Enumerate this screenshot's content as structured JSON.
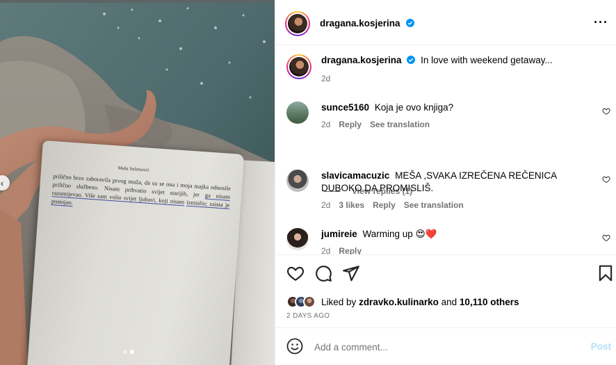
{
  "post": {
    "author": "dragana.kosjerina",
    "caption": "In love with weekend getaway...",
    "caption_time": "2d",
    "more_icon": "more-horizontal-icon",
    "verified_color": "#0095f6"
  },
  "photo": {
    "book_header": "Meša Selimović",
    "book_line1": "prilično brzo zaboravila prvog muža, da su se ona i moja majka",
    "book_line2": "odnosile prilično službeno. Nisam prihvatio svijet starijih, jer",
    "book_line3": "ga nisam razumijevao. Više sam volio svijet ljubavi, koji nisam",
    "book_line4": "izmislio; zaista je postojao.",
    "prev_icon": "chevron-left-icon"
  },
  "comments": [
    {
      "username": "sunce5160",
      "text": "Koja je ovo knjiga?",
      "time": "2d",
      "likes": "",
      "reply": "Reply",
      "translate": "See translation"
    },
    {
      "username": "slavicamacuzic",
      "text": "MEŠA ,SVAKA IZREČENA REČENICA DUBOKO DA PROMISLIŠ.",
      "time": "2d",
      "likes": "3 likes",
      "reply": "Reply",
      "translate": "See translation"
    },
    {
      "username": "jumireie",
      "text": "Warming up 😍❤️",
      "time": "2d",
      "likes": "",
      "reply": "Reply",
      "translate": ""
    }
  ],
  "view_replies": "View replies (1)",
  "actions": {
    "liked_by_prefix": "Liked by",
    "liked_by_user": "zdravko.kulinarko",
    "and": "and",
    "others": "10,110 others",
    "date": "2 DAYS AGO"
  },
  "add_comment": {
    "placeholder": "Add a comment...",
    "post": "Post"
  },
  "colors": {
    "link_blue": "#0095f6",
    "post_disabled": "#b2dffc",
    "meta_gray": "#737373",
    "divider": "#efefef"
  }
}
